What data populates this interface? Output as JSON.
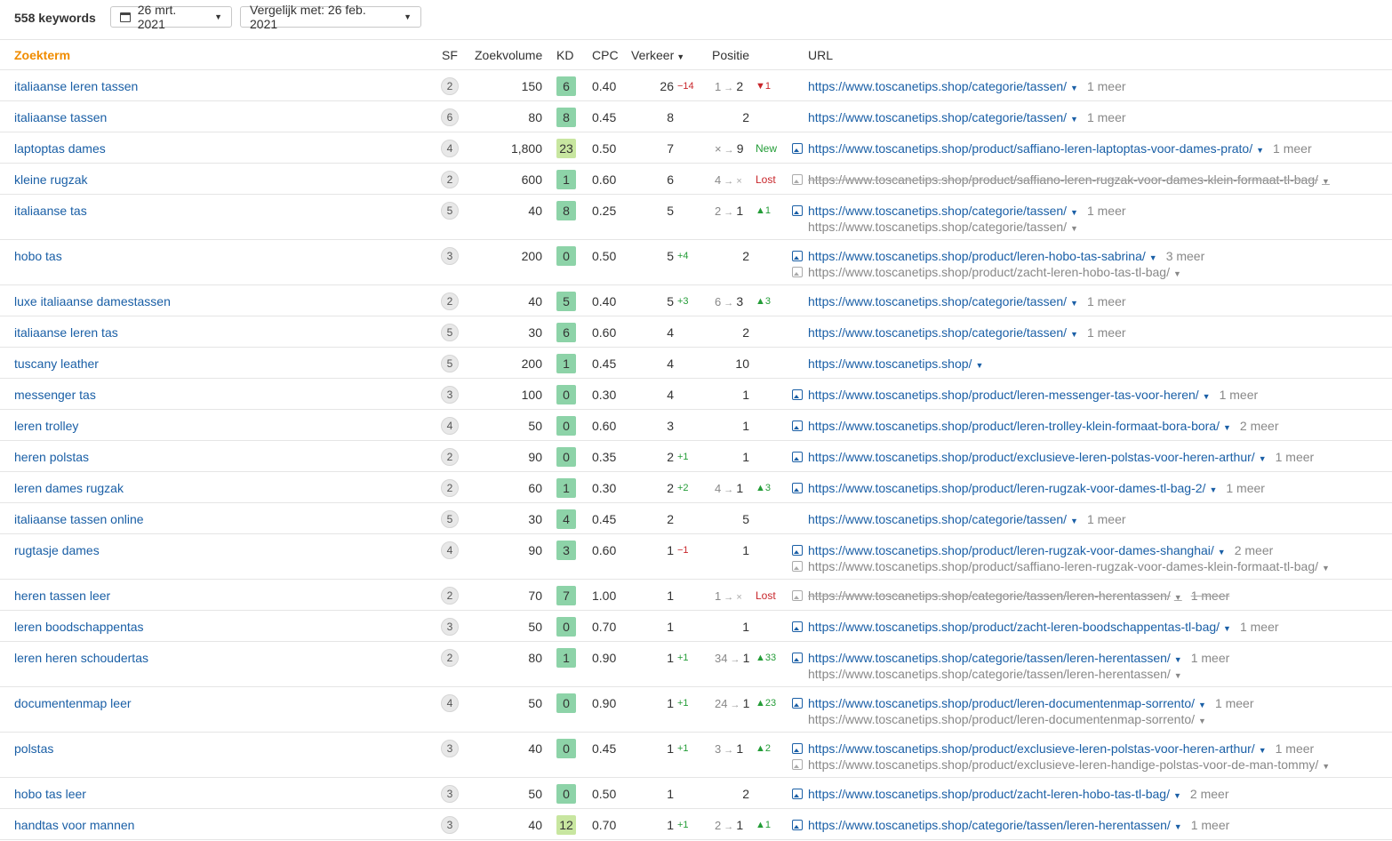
{
  "header": {
    "keyword_count": "558 keywords",
    "date_label": "26 mrt. 2021",
    "compare_label": "Vergelijk met: 26 feb. 2021"
  },
  "columns": {
    "keyword": "Zoekterm",
    "sf": "SF",
    "volume": "Zoekvolume",
    "kd": "KD",
    "cpc": "CPC",
    "traffic": "Verkeer",
    "position": "Positie",
    "url": "URL"
  },
  "kd_colors": {
    "green": "#8dd3a8",
    "light": "#c8e6a0"
  },
  "rows": [
    {
      "kw": "italiaanse leren tassen",
      "sf": "2",
      "vol": "150",
      "kd": "6",
      "cpc": "0.40",
      "traf": "26",
      "tdelta": "−14",
      "tdir": "down",
      "pfrom": "1",
      "pos": "2",
      "pdelta": "1",
      "pdir": "down",
      "img": "",
      "url": "https://www.toscanetips.shop/categorie/tassen/",
      "meer": "1 meer",
      "url2": "",
      "img2": ""
    },
    {
      "kw": "italiaanse tassen",
      "sf": "6",
      "vol": "80",
      "kd": "8",
      "cpc": "0.45",
      "traf": "8",
      "tdelta": "",
      "tdir": "",
      "pfrom": "",
      "pos": "2",
      "pdelta": "",
      "pdir": "",
      "img": "",
      "url": "https://www.toscanetips.shop/categorie/tassen/",
      "meer": "1 meer",
      "url2": "",
      "img2": ""
    },
    {
      "kw": "laptoptas dames",
      "sf": "4",
      "vol": "1,800",
      "kd": "23",
      "cpc": "0.50",
      "traf": "7",
      "tdelta": "",
      "tdir": "",
      "pfrom": "×",
      "pos": "9",
      "pdelta": "New",
      "pdir": "new",
      "img": "blue",
      "url": "https://www.toscanetips.shop/product/saffiano-leren-laptoptas-voor-dames-prato/",
      "meer": "1 meer",
      "url2": "",
      "img2": ""
    },
    {
      "kw": "kleine rugzak",
      "sf": "2",
      "vol": "600",
      "kd": "1",
      "cpc": "0.60",
      "traf": "6",
      "tdelta": "",
      "tdir": "",
      "pfrom": "4",
      "pos": "×",
      "pdelta": "Lost",
      "pdir": "lost",
      "img": "grey",
      "url": "https://www.toscanetips.shop/product/saffiano-leren-rugzak-voor-dames-klein-formaat-tl-bag/",
      "meer": "",
      "url2": "",
      "img2": ""
    },
    {
      "kw": "italiaanse tas",
      "sf": "5",
      "vol": "40",
      "kd": "8",
      "cpc": "0.25",
      "traf": "5",
      "tdelta": "",
      "tdir": "",
      "pfrom": "2",
      "pos": "1",
      "pdelta": "1",
      "pdir": "up",
      "img": "blue",
      "url": "https://www.toscanetips.shop/categorie/tassen/",
      "meer": "1 meer",
      "url2": "https://www.toscanetips.shop/categorie/tassen/",
      "img2": ""
    },
    {
      "kw": "hobo tas",
      "sf": "3",
      "vol": "200",
      "kd": "0",
      "cpc": "0.50",
      "traf": "5",
      "tdelta": "+4",
      "tdir": "up",
      "pfrom": "",
      "pos": "2",
      "pdelta": "",
      "pdir": "",
      "img": "blue",
      "url": "https://www.toscanetips.shop/product/leren-hobo-tas-sabrina/",
      "meer": "3 meer",
      "url2": "https://www.toscanetips.shop/product/zacht-leren-hobo-tas-tl-bag/",
      "img2": "grey"
    },
    {
      "kw": "luxe italiaanse damestassen",
      "sf": "2",
      "vol": "40",
      "kd": "5",
      "cpc": "0.40",
      "traf": "5",
      "tdelta": "+3",
      "tdir": "up",
      "pfrom": "6",
      "pos": "3",
      "pdelta": "3",
      "pdir": "up",
      "img": "",
      "url": "https://www.toscanetips.shop/categorie/tassen/",
      "meer": "1 meer",
      "url2": "",
      "img2": ""
    },
    {
      "kw": "italiaanse leren tas",
      "sf": "5",
      "vol": "30",
      "kd": "6",
      "cpc": "0.60",
      "traf": "4",
      "tdelta": "",
      "tdir": "",
      "pfrom": "",
      "pos": "2",
      "pdelta": "",
      "pdir": "",
      "img": "",
      "url": "https://www.toscanetips.shop/categorie/tassen/",
      "meer": "1 meer",
      "url2": "",
      "img2": ""
    },
    {
      "kw": "tuscany leather",
      "sf": "5",
      "vol": "200",
      "kd": "1",
      "cpc": "0.45",
      "traf": "4",
      "tdelta": "",
      "tdir": "",
      "pfrom": "",
      "pos": "10",
      "pdelta": "",
      "pdir": "",
      "img": "",
      "url": "https://www.toscanetips.shop/",
      "meer": "",
      "url2": "",
      "img2": ""
    },
    {
      "kw": "messenger tas",
      "sf": "3",
      "vol": "100",
      "kd": "0",
      "cpc": "0.30",
      "traf": "4",
      "tdelta": "",
      "tdir": "",
      "pfrom": "",
      "pos": "1",
      "pdelta": "",
      "pdir": "",
      "img": "blue",
      "url": "https://www.toscanetips.shop/product/leren-messenger-tas-voor-heren/",
      "meer": "1 meer",
      "url2": "",
      "img2": ""
    },
    {
      "kw": "leren trolley",
      "sf": "4",
      "vol": "50",
      "kd": "0",
      "cpc": "0.60",
      "traf": "3",
      "tdelta": "",
      "tdir": "",
      "pfrom": "",
      "pos": "1",
      "pdelta": "",
      "pdir": "",
      "img": "blue",
      "url": "https://www.toscanetips.shop/product/leren-trolley-klein-formaat-bora-bora/",
      "meer": "2 meer",
      "url2": "",
      "img2": ""
    },
    {
      "kw": "heren polstas",
      "sf": "2",
      "vol": "90",
      "kd": "0",
      "cpc": "0.35",
      "traf": "2",
      "tdelta": "+1",
      "tdir": "up",
      "pfrom": "",
      "pos": "1",
      "pdelta": "",
      "pdir": "",
      "img": "blue",
      "url": "https://www.toscanetips.shop/product/exclusieve-leren-polstas-voor-heren-arthur/",
      "meer": "1 meer",
      "url2": "",
      "img2": ""
    },
    {
      "kw": "leren dames rugzak",
      "sf": "2",
      "vol": "60",
      "kd": "1",
      "cpc": "0.30",
      "traf": "2",
      "tdelta": "+2",
      "tdir": "up",
      "pfrom": "4",
      "pos": "1",
      "pdelta": "3",
      "pdir": "up",
      "img": "blue",
      "url": "https://www.toscanetips.shop/product/leren-rugzak-voor-dames-tl-bag-2/",
      "meer": "1 meer",
      "url2": "",
      "img2": ""
    },
    {
      "kw": "italiaanse tassen online",
      "sf": "5",
      "vol": "30",
      "kd": "4",
      "cpc": "0.45",
      "traf": "2",
      "tdelta": "",
      "tdir": "",
      "pfrom": "",
      "pos": "5",
      "pdelta": "",
      "pdir": "",
      "img": "",
      "url": "https://www.toscanetips.shop/categorie/tassen/",
      "meer": "1 meer",
      "url2": "",
      "img2": ""
    },
    {
      "kw": "rugtasje dames",
      "sf": "4",
      "vol": "90",
      "kd": "3",
      "cpc": "0.60",
      "traf": "1",
      "tdelta": "−1",
      "tdir": "down",
      "pfrom": "",
      "pos": "1",
      "pdelta": "",
      "pdir": "",
      "img": "blue",
      "url": "https://www.toscanetips.shop/product/leren-rugzak-voor-dames-shanghai/",
      "meer": "2 meer",
      "url2": "https://www.toscanetips.shop/product/saffiano-leren-rugzak-voor-dames-klein-formaat-tl-bag/",
      "img2": "grey"
    },
    {
      "kw": "heren tassen leer",
      "sf": "2",
      "vol": "70",
      "kd": "7",
      "cpc": "1.00",
      "traf": "1",
      "tdelta": "",
      "tdir": "",
      "pfrom": "1",
      "pos": "×",
      "pdelta": "Lost",
      "pdir": "lost",
      "img": "grey",
      "url": "https://www.toscanetips.shop/categorie/tassen/leren-herentassen/",
      "meer": "1 meer",
      "url2": "",
      "img2": ""
    },
    {
      "kw": "leren boodschappentas",
      "sf": "3",
      "vol": "50",
      "kd": "0",
      "cpc": "0.70",
      "traf": "1",
      "tdelta": "",
      "tdir": "",
      "pfrom": "",
      "pos": "1",
      "pdelta": "",
      "pdir": "",
      "img": "blue",
      "url": "https://www.toscanetips.shop/product/zacht-leren-boodschappentas-tl-bag/",
      "meer": "1 meer",
      "url2": "",
      "img2": ""
    },
    {
      "kw": "leren heren schoudertas",
      "sf": "2",
      "vol": "80",
      "kd": "1",
      "cpc": "0.90",
      "traf": "1",
      "tdelta": "+1",
      "tdir": "up",
      "pfrom": "34",
      "pos": "1",
      "pdelta": "33",
      "pdir": "up",
      "img": "blue",
      "url": "https://www.toscanetips.shop/categorie/tassen/leren-herentassen/",
      "meer": "1 meer",
      "url2": "https://www.toscanetips.shop/categorie/tassen/leren-herentassen/",
      "img2": ""
    },
    {
      "kw": "documentenmap leer",
      "sf": "4",
      "vol": "50",
      "kd": "0",
      "cpc": "0.90",
      "traf": "1",
      "tdelta": "+1",
      "tdir": "up",
      "pfrom": "24",
      "pos": "1",
      "pdelta": "23",
      "pdir": "up",
      "img": "blue",
      "url": "https://www.toscanetips.shop/product/leren-documentenmap-sorrento/",
      "meer": "1 meer",
      "url2": "https://www.toscanetips.shop/product/leren-documentenmap-sorrento/",
      "img2": ""
    },
    {
      "kw": "polstas",
      "sf": "3",
      "vol": "40",
      "kd": "0",
      "cpc": "0.45",
      "traf": "1",
      "tdelta": "+1",
      "tdir": "up",
      "pfrom": "3",
      "pos": "1",
      "pdelta": "2",
      "pdir": "up",
      "img": "blue",
      "url": "https://www.toscanetips.shop/product/exclusieve-leren-polstas-voor-heren-arthur/",
      "meer": "1 meer",
      "url2": "https://www.toscanetips.shop/product/exclusieve-leren-handige-polstas-voor-de-man-tommy/",
      "img2": "grey"
    },
    {
      "kw": "hobo tas leer",
      "sf": "3",
      "vol": "50",
      "kd": "0",
      "cpc": "0.50",
      "traf": "1",
      "tdelta": "",
      "tdir": "",
      "pfrom": "",
      "pos": "2",
      "pdelta": "",
      "pdir": "",
      "img": "blue",
      "url": "https://www.toscanetips.shop/product/zacht-leren-hobo-tas-tl-bag/",
      "meer": "2 meer",
      "url2": "",
      "img2": ""
    },
    {
      "kw": "handtas voor mannen",
      "sf": "3",
      "vol": "40",
      "kd": "12",
      "cpc": "0.70",
      "traf": "1",
      "tdelta": "+1",
      "tdir": "up",
      "pfrom": "2",
      "pos": "1",
      "pdelta": "1",
      "pdir": "up",
      "img": "blue",
      "url": "https://www.toscanetips.shop/categorie/tassen/leren-herentassen/",
      "meer": "1 meer",
      "url2": "",
      "img2": ""
    }
  ]
}
